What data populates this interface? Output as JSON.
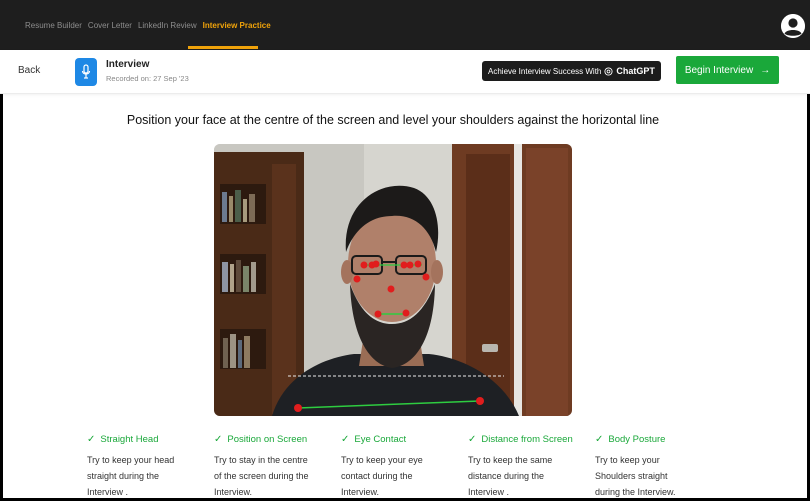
{
  "nav": {
    "items": [
      {
        "label": "Resume Builder",
        "active": false
      },
      {
        "label": "Cover Letter",
        "active": false
      },
      {
        "label": "LinkedIn Review",
        "active": false
      },
      {
        "label": "Interview Practice",
        "active": true
      }
    ],
    "accent_color": "#f0a30a"
  },
  "subheader": {
    "back_label": "Back",
    "title": "Interview",
    "recorded": "Recorded on: 27 Sep '23",
    "chatgpt_prefix": "Achieve Interview Success With",
    "chatgpt_brand": "ChatGPT",
    "begin_label": "Begin Interview",
    "begin_color": "#1aa83a",
    "mic_color": "#1e88e5"
  },
  "instruction": "Position your face at the centre of the screen and level your shoulders against the horizontal line",
  "tips": [
    {
      "title": "Straight Head",
      "line1": "Try to keep your head",
      "line2": "straight during the",
      "line3": "Interview ."
    },
    {
      "title": "Position on Screen",
      "line1": "Try to stay in the centre",
      "line2": "of the screen during the",
      "line3": "Interview."
    },
    {
      "title": "Eye Contact",
      "line1": "Try to keep your eye",
      "line2": "contact during the",
      "line3": "Interview."
    },
    {
      "title": "Distance from Screen",
      "line1": "Try to keep the same",
      "line2": "distance during the",
      "line3": "Interview ."
    },
    {
      "title": "Body Posture",
      "line1": "Try to keep your",
      "line2": "Shoulders straight",
      "line3": "during the Interview."
    }
  ],
  "icons": {
    "avatar": "user-circle-icon",
    "mic": "microphone-icon",
    "chatgpt": "openai-logo-icon",
    "arrow": "arrow-right-icon",
    "check": "check-icon"
  }
}
